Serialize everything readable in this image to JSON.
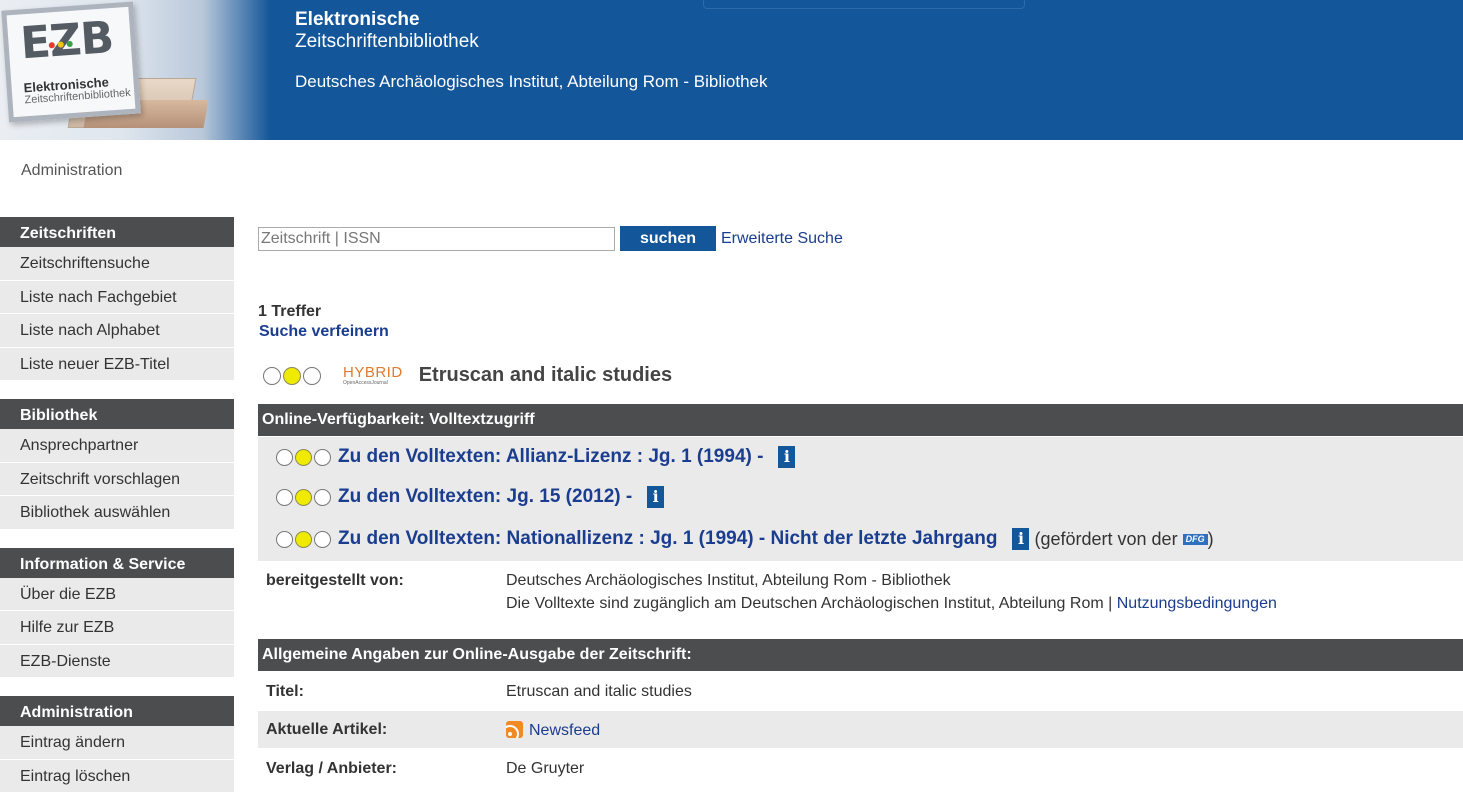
{
  "header": {
    "logo": {
      "ezb": "EZB",
      "line1": "Elektronische",
      "line2": "Zeitschriftenbibliothek"
    },
    "title_line1": "Elektronische",
    "title_line2": "Zeitschriftenbibliothek",
    "institution": "Deutsches Archäologisches Institut, Abteilung Rom - Bibliothek"
  },
  "top_link": "Administration",
  "sidebar": {
    "groups": [
      {
        "title": "Zeitschriften",
        "items": [
          "Zeitschriftensuche",
          "Liste nach Fachgebiet",
          "Liste nach Alphabet",
          "Liste neuer EZB-Titel"
        ]
      },
      {
        "title": "Bibliothek",
        "items": [
          "Ansprechpartner",
          "Zeitschrift vorschlagen",
          "Bibliothek auswählen"
        ]
      },
      {
        "title": "Information & Service",
        "items": [
          "Über die EZB",
          "Hilfe zur EZB",
          "EZB-Dienste"
        ]
      },
      {
        "title": "Administration",
        "items": [
          "Eintrag ändern",
          "Eintrag löschen"
        ]
      }
    ]
  },
  "search": {
    "placeholder": "Zeitschrift | ISSN",
    "button": "suchen",
    "advanced": "Erweiterte Suche"
  },
  "results": {
    "count": "1 Treffer",
    "refine": "Suche verfeinern"
  },
  "journal": {
    "badge_main": "HYBRID",
    "badge_sub": "OpenAccessJournal",
    "title": "Etruscan and italic studies"
  },
  "availability": {
    "heading": "Online-Verfügbarkeit: Volltextzugriff",
    "links": [
      {
        "text": "Zu den Volltexten: Allianz-Lizenz : Jg. 1 (1994) -"
      },
      {
        "text": "Zu den Volltexten: Jg. 15 (2012) -"
      },
      {
        "text": "Zu den Volltexten: Nationallizenz : Jg. 1 (1994) - Nicht der letzte Jahrgang"
      }
    ],
    "info_icon": "i",
    "funded_prefix": "(gefördert von der",
    "funded_suffix": ")",
    "dfg_logo": "DFG"
  },
  "provided": {
    "label": "bereitgestellt von:",
    "line1": "Deutsches Archäologisches Institut, Abteilung Rom - Bibliothek",
    "line2": "Die Volltexte sind zugänglich am Deutschen Archäologischen Institut, Abteilung Rom |",
    "terms_link": "Nutzungsbedingungen"
  },
  "general": {
    "heading": "Allgemeine Angaben zur Online-Ausgabe der Zeitschrift:",
    "title_label": "Titel:",
    "title_value": "Etruscan and italic studies",
    "articles_label": "Aktuelle Artikel:",
    "articles_link": "Newsfeed",
    "publisher_label": "Verlag / Anbieter:",
    "publisher_value": "De Gruyter"
  },
  "colors": {
    "header_blue": "#14569a",
    "sidebar_head": "#4b4d4e",
    "link": "#1a3d8f",
    "traffic_yellow": "#f0e900"
  }
}
